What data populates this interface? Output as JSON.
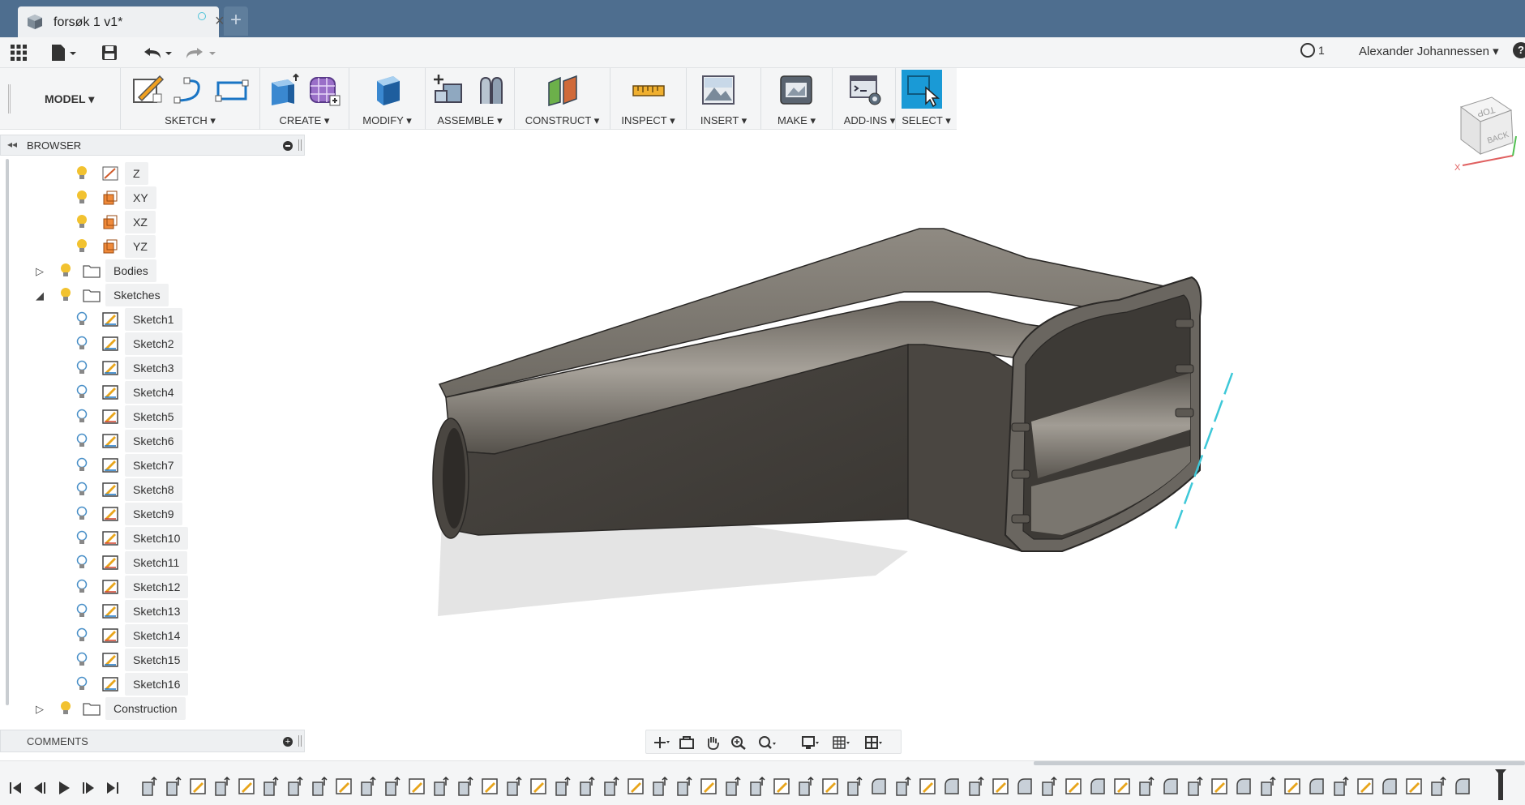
{
  "window": {
    "tab_title": "forsøk 1 v1*",
    "new_tab_label": "+"
  },
  "quick_access": {
    "job_status_count": "1",
    "user_name": "Alexander Johannessen ▾",
    "help_label": "?"
  },
  "ribbon": {
    "workspace": "MODEL ▾",
    "groups": [
      {
        "label": "SKETCH ▾"
      },
      {
        "label": "CREATE ▾"
      },
      {
        "label": "MODIFY ▾"
      },
      {
        "label": "ASSEMBLE ▾"
      },
      {
        "label": "CONSTRUCT ▾"
      },
      {
        "label": "INSPECT ▾"
      },
      {
        "label": "INSERT ▾"
      },
      {
        "label": "MAKE ▾"
      },
      {
        "label": "ADD-INS ▾"
      },
      {
        "label": "SELECT ▾"
      }
    ]
  },
  "browser": {
    "title": "BROWSER",
    "collapse_icon": "◂◂",
    "items": [
      {
        "label": "Z"
      },
      {
        "label": "XY"
      },
      {
        "label": "XZ"
      },
      {
        "label": "YZ"
      },
      {
        "label": "Bodies"
      },
      {
        "label": "Sketches"
      },
      {
        "label": "Sketch1"
      },
      {
        "label": "Sketch2"
      },
      {
        "label": "Sketch3"
      },
      {
        "label": "Sketch4"
      },
      {
        "label": "Sketch5"
      },
      {
        "label": "Sketch6"
      },
      {
        "label": "Sketch7"
      },
      {
        "label": "Sketch8"
      },
      {
        "label": "Sketch9"
      },
      {
        "label": "Sketch10"
      },
      {
        "label": "Sketch11"
      },
      {
        "label": "Sketch12"
      },
      {
        "label": "Sketch13"
      },
      {
        "label": "Sketch14"
      },
      {
        "label": "Sketch15"
      },
      {
        "label": "Sketch16"
      },
      {
        "label": "Construction"
      }
    ]
  },
  "comments": {
    "title": "COMMENTS",
    "add_label": "+"
  },
  "viewcube": {
    "top_face": "TOP",
    "back_face": "BACK",
    "axis_x": "X"
  },
  "colors": {
    "titlebar": "#4e6e8f",
    "accent": "#1a9ad6",
    "sketch_icon": "#e8a51c",
    "bulb": "#f2c230"
  },
  "timeline": {
    "feature_count": 55
  }
}
